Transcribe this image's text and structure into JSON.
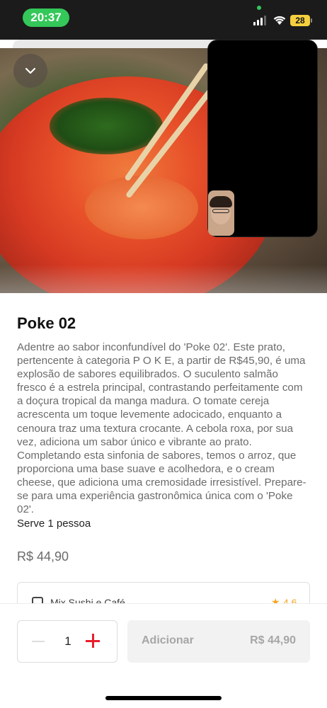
{
  "status_bar": {
    "time": "20:37",
    "battery": "28"
  },
  "product": {
    "title": "Poke 02",
    "description": "Adentre ao sabor inconfundível do 'Poke 02'. Este prato, pertencente à categoria P O K E, a partir de R$45,90, é uma explosão de sabores equilibrados. O suculento salmão fresco é a estrela principal, contrastando perfeitamente com a doçura tropical da manga madura. O tomate cereja acrescenta um toque levemente adocicado, enquanto a cenoura traz uma textura crocante. A cebola roxa, por sua vez, adiciona um sabor único e vibrante ao prato. Completando esta sinfonia de sabores, temos o arroz, que proporciona uma base suave e acolhedora, e o cream cheese, que adiciona uma cremosidade irresistível. Prepare-se para uma experiência gastronômica única com o 'Poke 02'.",
    "serves": "Serve 1 pessoa",
    "price": "R$ 44,90"
  },
  "store": {
    "name": "Mix Sushi e Café",
    "rating": "4,6",
    "icons": {
      "store": "store-icon",
      "rating": "star-icon"
    }
  },
  "cart": {
    "quantity": "1",
    "add_label": "Adicionar",
    "add_price": "R$ 44,90"
  },
  "icons": {
    "collapse": "chevron-down-icon",
    "minus": "minus-icon",
    "plus": "plus-icon"
  },
  "colors": {
    "accent": "#ea1d2c",
    "status_pill": "#34c759",
    "rating": "#f5a623"
  }
}
